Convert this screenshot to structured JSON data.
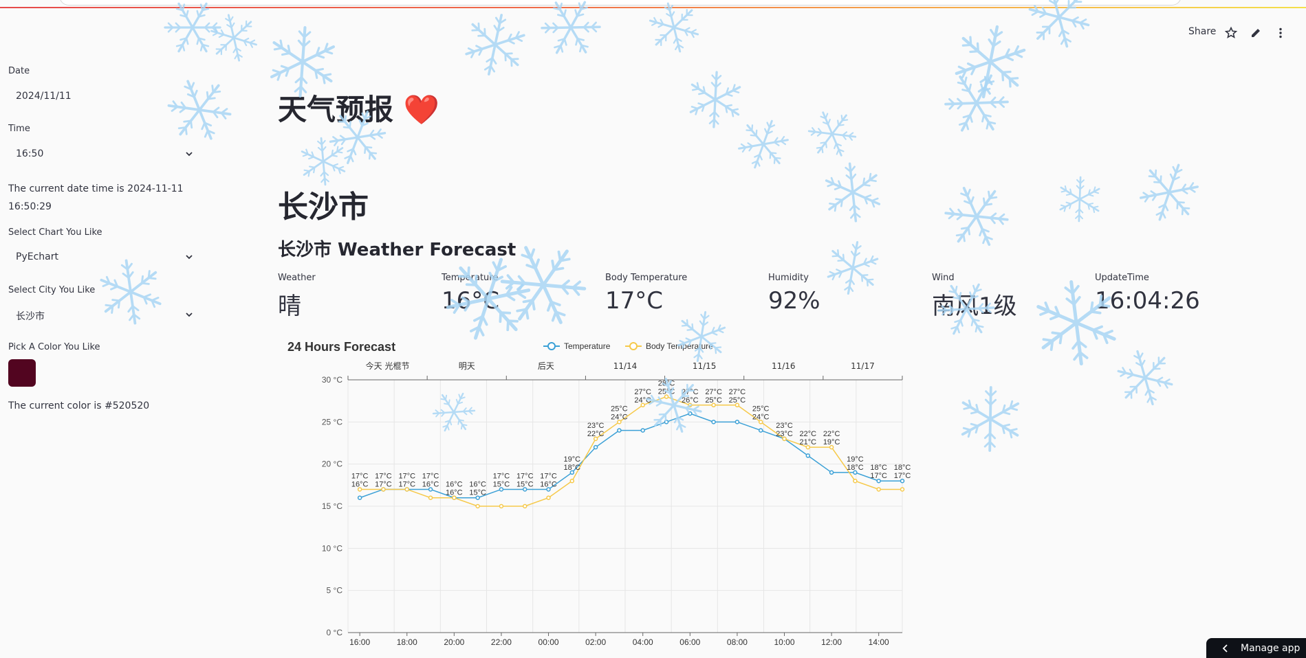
{
  "sidebar": {
    "date_label": "Date",
    "date_value": "2024/11/11",
    "time_label": "Time",
    "time_value": "16:50",
    "datetime_text": "The current date time is 2024-11-11 16:50:29",
    "chart_label": "Select Chart You Like",
    "chart_value": "PyEchart",
    "city_label": "Select City You Like",
    "city_value": "长沙市",
    "color_label": "Pick A Color You Like",
    "color_hex": "#520520",
    "color_text": "The current color is #520520"
  },
  "toolbar": {
    "share_label": "Share",
    "star_icon": "star-icon",
    "edit_icon": "pencil-icon",
    "more_icon": "more-vertical-icon"
  },
  "main": {
    "title": "天气预报",
    "title_emoji": "❤️",
    "city_heading": "长沙市",
    "forecast_heading": "长沙市 Weather Forecast",
    "metrics": [
      {
        "label": "Weather",
        "value": "晴"
      },
      {
        "label": "Temperature",
        "value": "16°C"
      },
      {
        "label": "Body Temperature",
        "value": "17°C"
      },
      {
        "label": "Humidity",
        "value": "92%"
      },
      {
        "label": "Wind",
        "value": "南风1级"
      },
      {
        "label": "UpdateTime",
        "value": "16:04:26"
      }
    ]
  },
  "footer": {
    "manage_label": "Manage app"
  },
  "colors": {
    "temperature": "#3ba0d6",
    "body_temperature": "#f6c94a",
    "primary_dark": "#0e1117",
    "swatch": "#520520",
    "snow": "#a9d6f5"
  },
  "chart_data": {
    "type": "line",
    "title": "24 Hours Forecast",
    "top_axis_labels": [
      "今天 光棍节",
      "明天",
      "后天",
      "11/14",
      "11/15",
      "11/16",
      "11/17"
    ],
    "x": [
      "16:00",
      "17:00",
      "18:00",
      "19:00",
      "20:00",
      "21:00",
      "22:00",
      "23:00",
      "00:00",
      "01:00",
      "02:00",
      "03:00",
      "04:00",
      "05:00",
      "06:00",
      "07:00",
      "08:00",
      "09:00",
      "10:00",
      "11:00",
      "12:00",
      "13:00",
      "14:00",
      "15:00"
    ],
    "x_tick_labels": [
      "16:00",
      "18:00",
      "20:00",
      "22:00",
      "00:00",
      "02:00",
      "04:00",
      "06:00",
      "08:00",
      "10:00",
      "12:00",
      "14:00"
    ],
    "y_tick_labels": [
      "0 °C",
      "5 °C",
      "10 °C",
      "15 °C",
      "20 °C",
      "25 °C",
      "30 °C"
    ],
    "ylim": [
      0,
      30
    ],
    "grid": true,
    "legend_position": "top",
    "series": [
      {
        "name": "Temperature",
        "values": [
          16,
          17,
          17,
          17,
          16,
          16,
          17,
          17,
          17,
          19,
          22,
          24,
          24,
          25,
          26,
          25,
          25,
          24,
          23,
          21,
          19,
          19,
          18,
          18
        ]
      },
      {
        "name": "Body Temperature",
        "values": [
          17,
          17,
          17,
          16,
          16,
          15,
          15,
          15,
          16,
          18,
          23,
          25,
          27,
          28,
          27,
          27,
          27,
          25,
          23,
          22,
          22,
          18,
          17,
          17
        ]
      }
    ]
  }
}
